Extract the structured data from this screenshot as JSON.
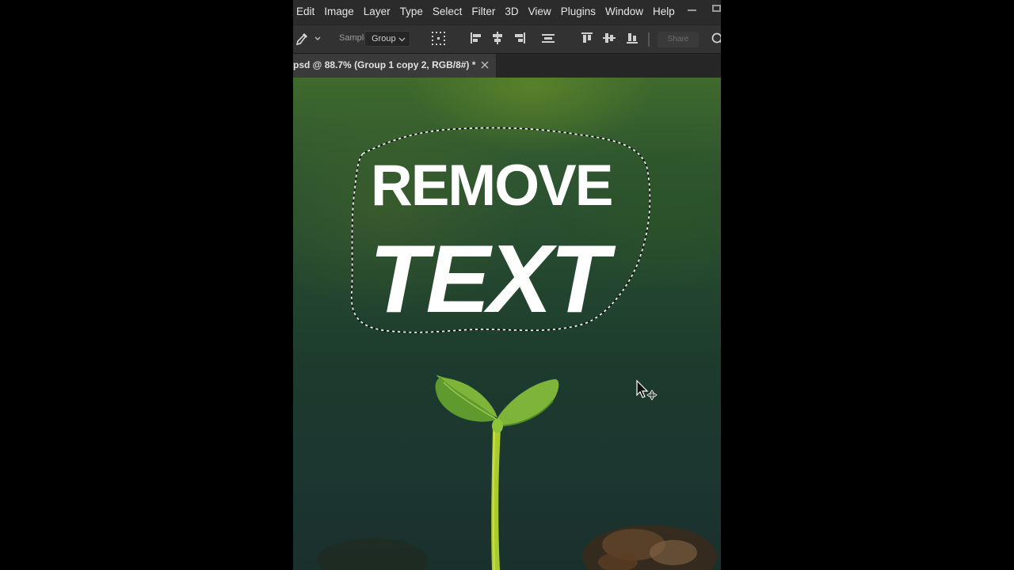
{
  "menubar": {
    "items": [
      "Edit",
      "Image",
      "Layer",
      "Type",
      "Select",
      "Filter",
      "3D",
      "View",
      "Plugins",
      "Window",
      "Help"
    ]
  },
  "options_bar": {
    "sample_label": "Sample",
    "sample_value": "Group",
    "share_label": "Share",
    "icons": [
      "eyedropper-icon",
      "chevron-down-icon",
      "distribute-icon",
      "align-left-icon",
      "align-center-icon",
      "align-right-icon",
      "distribute-horizontal-icon",
      "align-top-icon",
      "align-middle-icon",
      "align-bottom-icon",
      "search-icon"
    ]
  },
  "document_tab": {
    "label": "psd @ 88.7% (Group 1 copy 2, RGB/8#) *"
  },
  "canvas": {
    "headline_line1": "REMOVE",
    "headline_line2": "TEXT"
  },
  "colors": {
    "menubar_bg": "#2b2b2b",
    "optionsbar_bg": "#323232",
    "tab_bg": "#3a3a3a",
    "canvas_green": "#24472f",
    "sprout_green": "#8dc63f"
  }
}
